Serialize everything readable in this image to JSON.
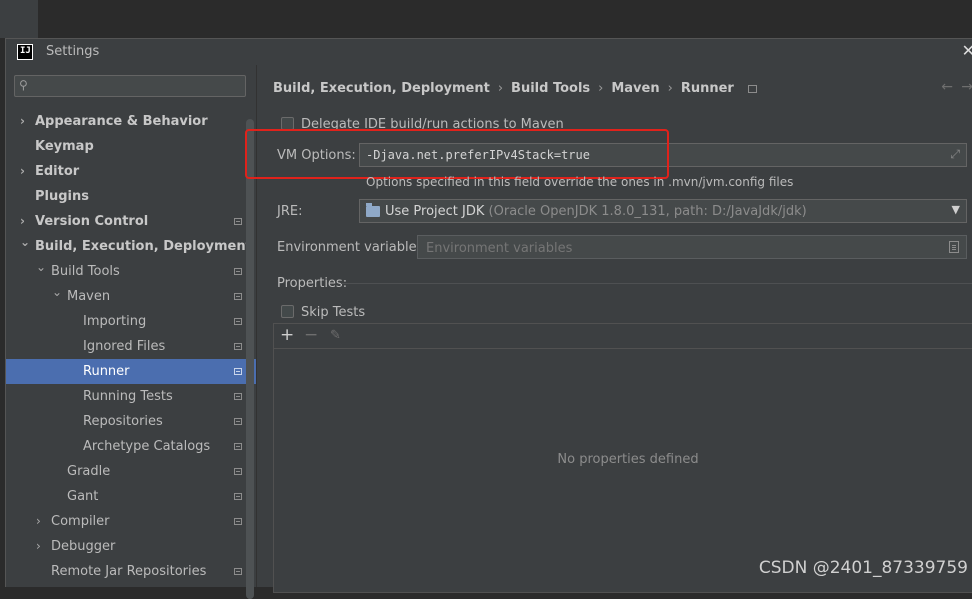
{
  "window": {
    "title": "Settings"
  },
  "search": {
    "placeholder": ""
  },
  "sidebar": {
    "items": [
      {
        "label": "Appearance & Behavior",
        "level": 0,
        "expandable": true,
        "expanded": false,
        "bold": true,
        "icon": false
      },
      {
        "label": "Keymap",
        "level": 0,
        "expandable": false,
        "bold": true,
        "icon": false
      },
      {
        "label": "Editor",
        "level": 0,
        "expandable": true,
        "expanded": false,
        "bold": true,
        "icon": false
      },
      {
        "label": "Plugins",
        "level": 0,
        "expandable": false,
        "bold": true,
        "icon": false
      },
      {
        "label": "Version Control",
        "level": 0,
        "expandable": true,
        "expanded": false,
        "bold": true,
        "icon": true
      },
      {
        "label": "Build, Execution, Deployment",
        "level": 0,
        "expandable": true,
        "expanded": true,
        "bold": true,
        "icon": false
      },
      {
        "label": "Build Tools",
        "level": 1,
        "expandable": true,
        "expanded": true,
        "bold": false,
        "icon": true
      },
      {
        "label": "Maven",
        "level": 2,
        "expandable": true,
        "expanded": true,
        "bold": false,
        "icon": true
      },
      {
        "label": "Importing",
        "level": 3,
        "expandable": false,
        "bold": false,
        "icon": true
      },
      {
        "label": "Ignored Files",
        "level": 3,
        "expandable": false,
        "bold": false,
        "icon": true
      },
      {
        "label": "Runner",
        "level": 3,
        "expandable": false,
        "bold": false,
        "icon": true,
        "selected": true
      },
      {
        "label": "Running Tests",
        "level": 3,
        "expandable": false,
        "bold": false,
        "icon": true
      },
      {
        "label": "Repositories",
        "level": 3,
        "expandable": false,
        "bold": false,
        "icon": true
      },
      {
        "label": "Archetype Catalogs",
        "level": 3,
        "expandable": false,
        "bold": false,
        "icon": true
      },
      {
        "label": "Gradle",
        "level": 2,
        "expandable": false,
        "bold": false,
        "icon": true
      },
      {
        "label": "Gant",
        "level": 2,
        "expandable": false,
        "bold": false,
        "icon": true
      },
      {
        "label": "Compiler",
        "level": 1,
        "expandable": true,
        "expanded": false,
        "bold": false,
        "icon": true
      },
      {
        "label": "Debugger",
        "level": 1,
        "expandable": true,
        "expanded": false,
        "bold": false,
        "icon": false
      },
      {
        "label": "Remote Jar Repositories",
        "level": 1,
        "expandable": false,
        "bold": false,
        "icon": true
      }
    ]
  },
  "breadcrumb": [
    "Build, Execution, Deployment",
    "Build Tools",
    "Maven",
    "Runner"
  ],
  "runner": {
    "delegate_label": "Delegate IDE build/run actions to Maven",
    "delegate_checked": false,
    "vm_options_label": "VM Options:",
    "vm_options_value": "-Djava.net.preferIPv4Stack=true",
    "vm_options_hint": "Options specified in this field override the ones in .mvn/jvm.config files",
    "jre_label": "JRE:",
    "jre_value": "Use Project JDK",
    "jre_detail": "(Oracle OpenJDK 1.8.0_131, path: D:/JavaJdk/jdk)",
    "env_label": "Environment variables:",
    "env_placeholder": "Environment variables",
    "properties_label": "Properties:",
    "skip_tests_label": "Skip Tests",
    "skip_tests_checked": false,
    "empty_properties": "No properties defined"
  },
  "icons": {
    "add": "+",
    "remove": "−",
    "edit": "✎",
    "back": "←",
    "forward": "→",
    "close": "✕",
    "search": "⚲"
  },
  "watermark": "CSDN @2401_87339759",
  "colors": {
    "selection": "#4b6eaf",
    "highlight_box": "#e0221b",
    "background": "#3c3f41"
  }
}
